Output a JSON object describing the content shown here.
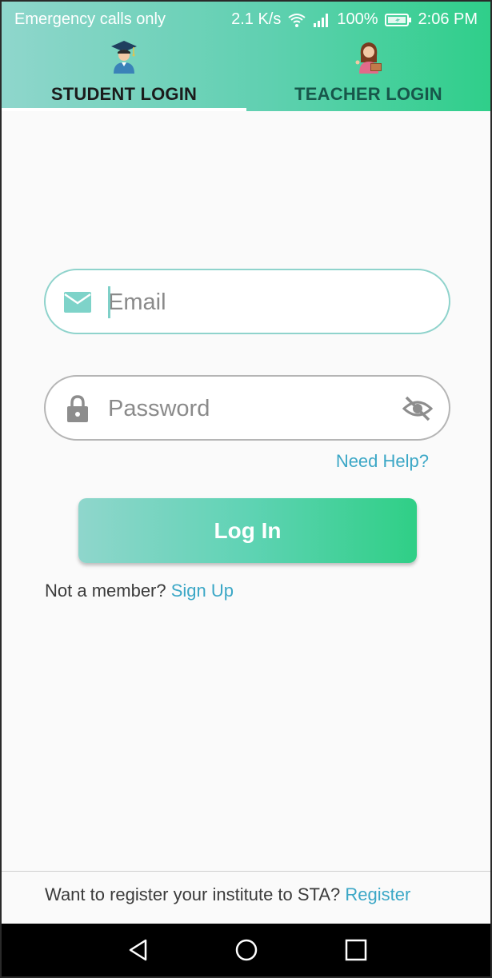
{
  "status_bar": {
    "carrier": "Emergency calls only",
    "speed": "2.1 K/s",
    "battery": "100%",
    "time": "2:06 PM",
    "icons": [
      "wifi-icon",
      "signal-icon",
      "battery-icon"
    ]
  },
  "tabs": [
    {
      "label": "STUDENT LOGIN",
      "icon": "student-graduate-icon",
      "selected": true
    },
    {
      "label": "TEACHER LOGIN",
      "icon": "teacher-icon",
      "selected": false
    }
  ],
  "form": {
    "email_placeholder": "Email",
    "email_value": "",
    "email_icon": "mail-icon",
    "password_placeholder": "Password",
    "password_value": "",
    "password_icon": "lock-icon",
    "visibility_icon": "eye-off-icon",
    "need_help": "Need Help?",
    "login_button": "Log In"
  },
  "signup": {
    "prompt": "Not a member?",
    "link": "Sign Up"
  },
  "register": {
    "prompt": "Want to register your institute to STA?",
    "link": "Register"
  },
  "nav_bar": {
    "icons": [
      "back-icon",
      "home-icon",
      "recent-apps-icon"
    ]
  },
  "colors": {
    "accent_start": "#8fd6cc",
    "accent_end": "#2fcf86",
    "link": "#3ba7c6"
  }
}
